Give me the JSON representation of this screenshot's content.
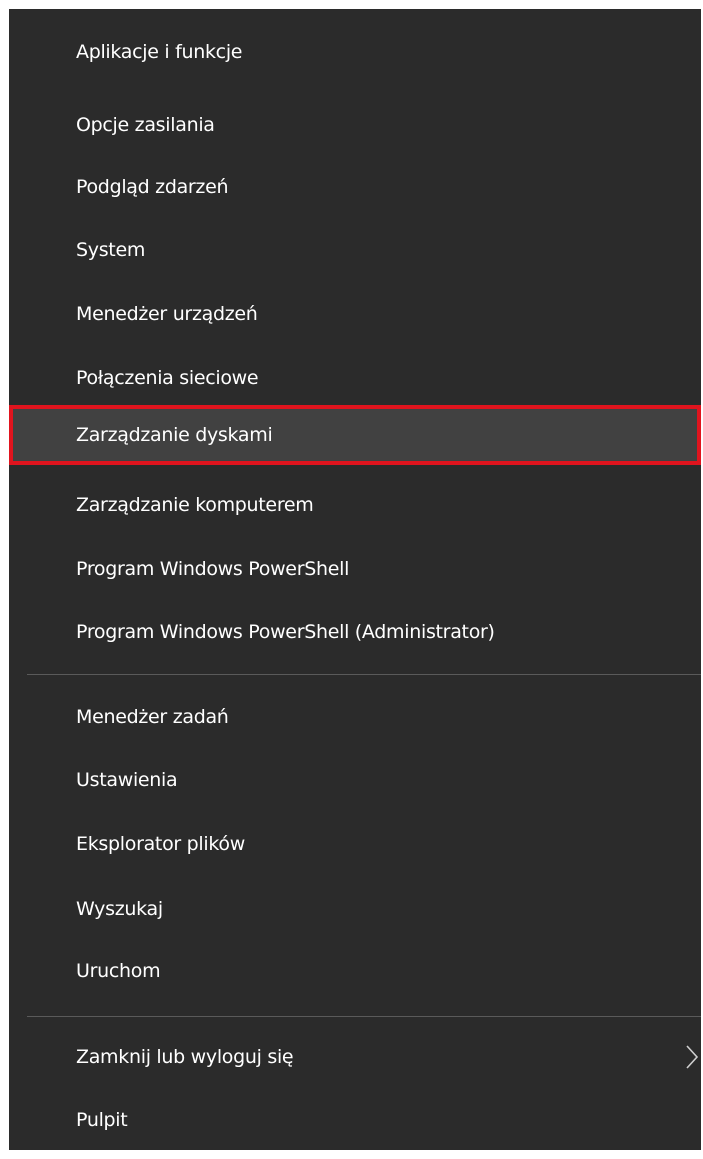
{
  "menu": {
    "items": [
      {
        "label": "Aplikacje i funkcje"
      },
      {
        "label": "Opcje zasilania"
      },
      {
        "label": "Podgląd zdarzeń"
      },
      {
        "label": "System"
      },
      {
        "label": "Menedżer urządzeń"
      },
      {
        "label": "Połączenia sieciowe"
      },
      {
        "label": "Zarządzanie dyskami",
        "highlighted": true
      },
      {
        "label": "Zarządzanie komputerem"
      },
      {
        "label": "Program Windows PowerShell"
      },
      {
        "label": "Program Windows PowerShell (Administrator)"
      },
      {
        "label": "Menedżer zadań"
      },
      {
        "label": "Ustawienia"
      },
      {
        "label": "Eksplorator plików"
      },
      {
        "label": "Wyszukaj"
      },
      {
        "label": "Uruchom"
      },
      {
        "label": "Zamknij lub wyloguj się",
        "submenu_icon": "chevron-right-icon"
      },
      {
        "label": "Pulpit"
      }
    ]
  },
  "colors": {
    "menu_background": "#2b2b2b",
    "highlight_background": "#414141",
    "highlight_border": "#e0141e",
    "text": "#ffffff",
    "separator": "#5a5a5a"
  }
}
